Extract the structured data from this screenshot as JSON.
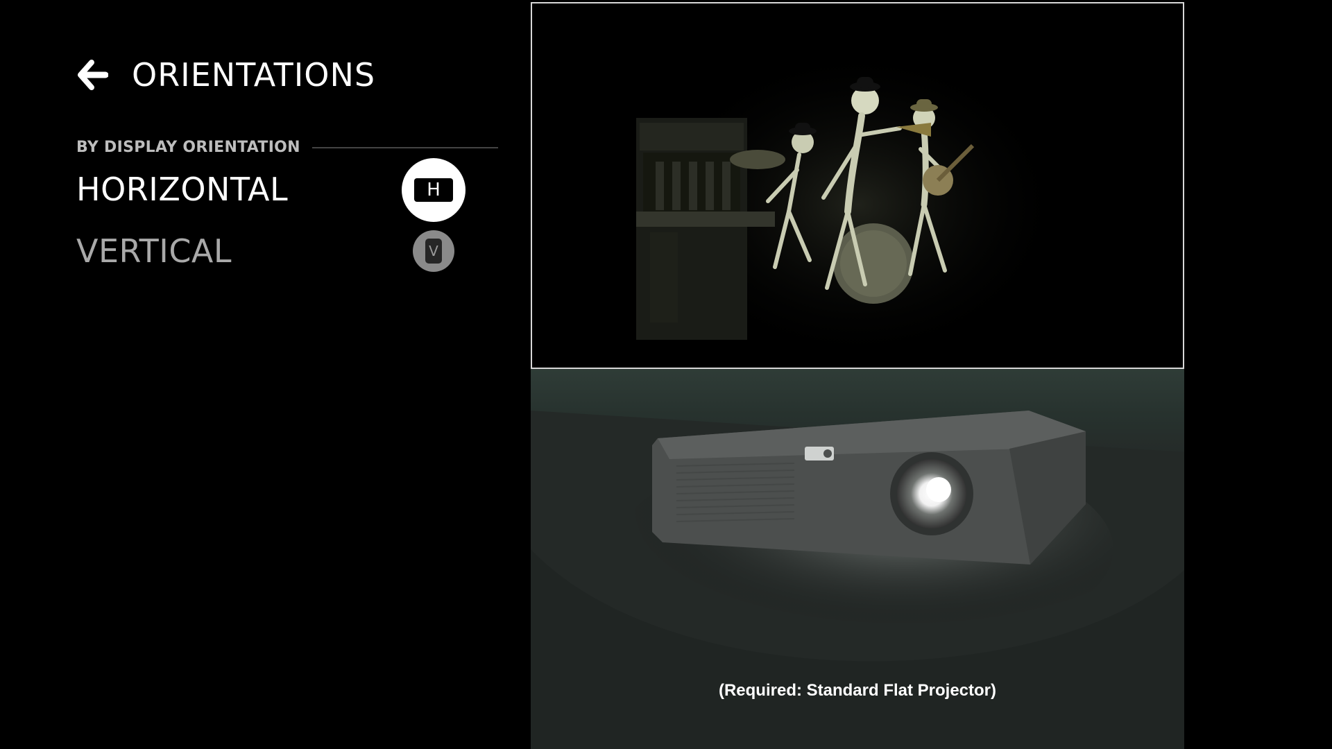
{
  "header": {
    "title": "ORIENTATIONS",
    "back_icon": "arrow-left-icon"
  },
  "section": {
    "label": "BY DISPLAY ORIENTATION"
  },
  "options": [
    {
      "label": "HORIZONTAL",
      "badge_letter": "H",
      "selected": true
    },
    {
      "label": "VERTICAL",
      "badge_letter": "V",
      "selected": false
    }
  ],
  "preview": {
    "caption": "(Required: Standard Flat Projector)"
  },
  "colors": {
    "background": "#000000",
    "selected_text": "#ffffff",
    "unselected_text": "#a9a9a9",
    "room_wall": "#2f3c37"
  }
}
